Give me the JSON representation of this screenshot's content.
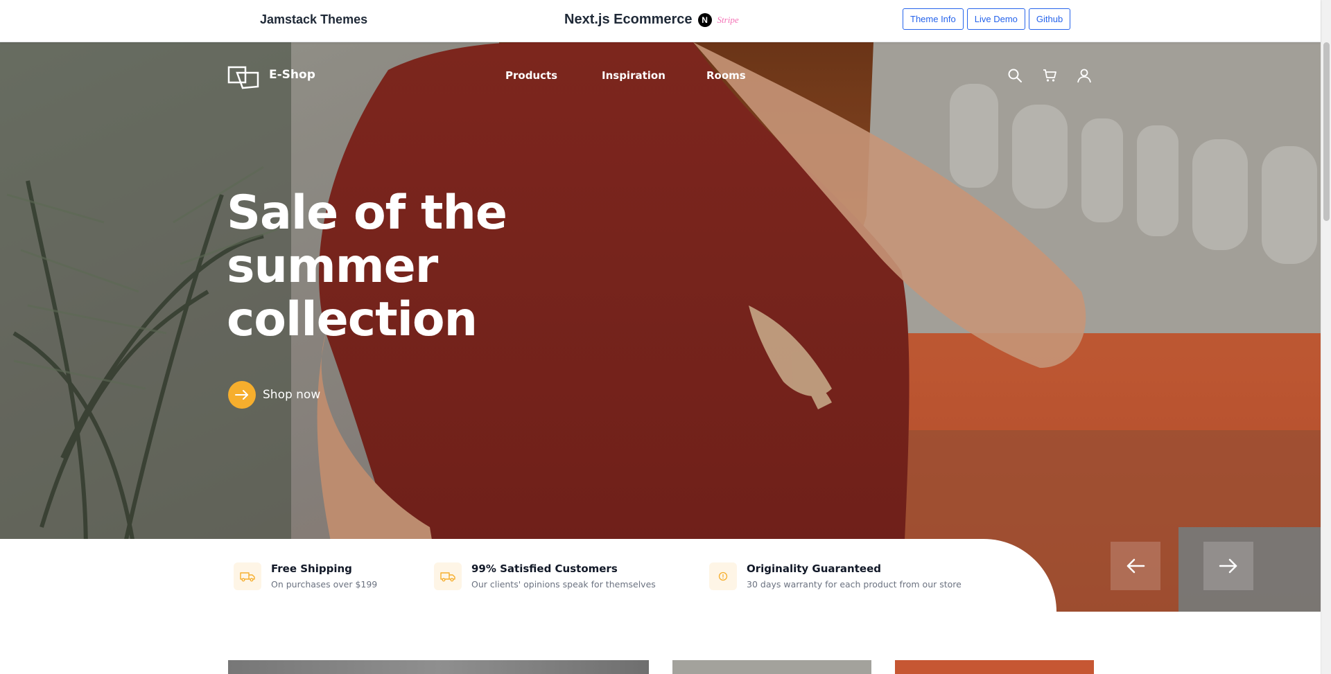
{
  "topbar": {
    "brand_left": "Jamstack Themes",
    "brand_center": "Next.js Ecommerce",
    "next_badge": "N",
    "stripe_mark": "Stripe",
    "buttons": [
      "Theme Info",
      "Live Demo",
      "Github"
    ]
  },
  "nav": {
    "logo_text": "E-Shop",
    "links": [
      "Products",
      "Inspiration",
      "Rooms"
    ],
    "icons": [
      "search-icon",
      "cart-icon",
      "user-icon"
    ]
  },
  "hero": {
    "headline": "Sale of the summer collection",
    "cta_label": "Shop now",
    "accent_color": "#f6ae2d"
  },
  "features": [
    {
      "title": "Free Shipping",
      "subtitle": "On purchases over $199",
      "icon": "truck-icon"
    },
    {
      "title": "99% Satisfied Customers",
      "subtitle": "Our clients' opinions speak for themselves",
      "icon": "truck-icon"
    },
    {
      "title": "Originality Guaranteed",
      "subtitle": "30 days warranty for each product from our store",
      "icon": "shield-icon"
    }
  ],
  "slider": {
    "prev_icon": "arrow-left-icon",
    "next_icon": "arrow-right-icon"
  }
}
